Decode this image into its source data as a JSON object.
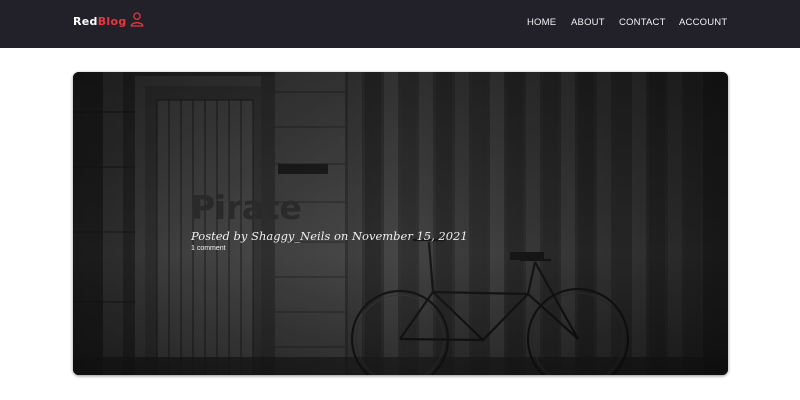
{
  "brand": {
    "part1": "Red",
    "part2": "Blog",
    "accent": "#e8363d"
  },
  "navbar": {
    "background": "#22212a",
    "items": [
      {
        "label": "HOME"
      },
      {
        "label": "ABOUT"
      },
      {
        "label": "CONTACT"
      },
      {
        "label": "ACCOUNT"
      }
    ]
  },
  "post": {
    "title": "Pirate",
    "meta_prefix": "Posted by",
    "author": "Shaggy_Neils",
    "date": "November 15, 2021",
    "comments": "1 comment",
    "image_icon": "barn-door-bicycle-photo"
  }
}
